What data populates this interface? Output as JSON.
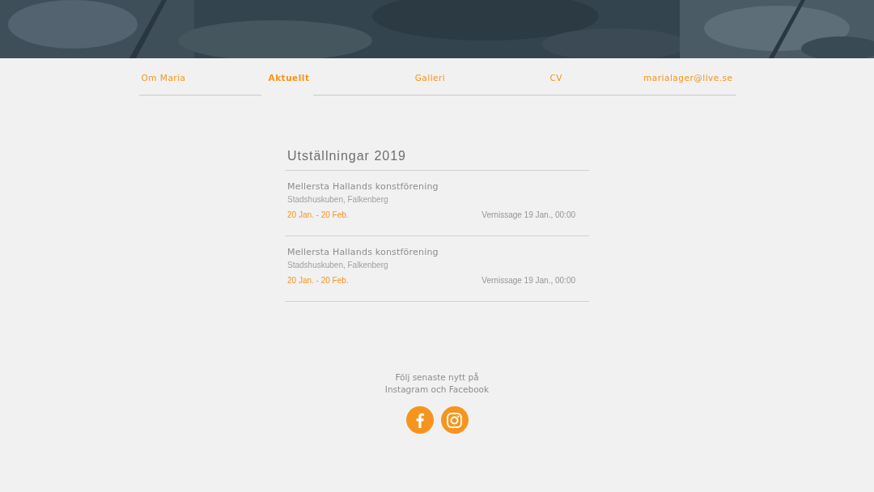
{
  "nav": [
    {
      "label": "Om Maria",
      "selected": false
    },
    {
      "label": "Aktuellt",
      "selected": true
    },
    {
      "label": "Galleri",
      "selected": false
    },
    {
      "label": "CV",
      "selected": false
    },
    {
      "label": "marialager@live.se",
      "selected": false
    }
  ],
  "section": {
    "title": "Utställningar 2019",
    "events": [
      {
        "title": "Mellersta Hallands konstförening",
        "place": "Stadshuskuben, Falkenberg",
        "dates": "20 Jan. - 20 Feb.",
        "opening": "Vernissage 19 Jan., 00:00"
      },
      {
        "title": "Mellersta Hallands konstförening",
        "place": "Stadshuskuben, Falkenberg",
        "dates": "20 Jan. - 20 Feb.",
        "opening": "Vernissage 19 Jan., 00:00"
      }
    ]
  },
  "footer": {
    "text": "Följ senaste nytt på Instagram och Facebook",
    "social": [
      {
        "kind": "facebook"
      },
      {
        "kind": "instagram"
      }
    ]
  }
}
